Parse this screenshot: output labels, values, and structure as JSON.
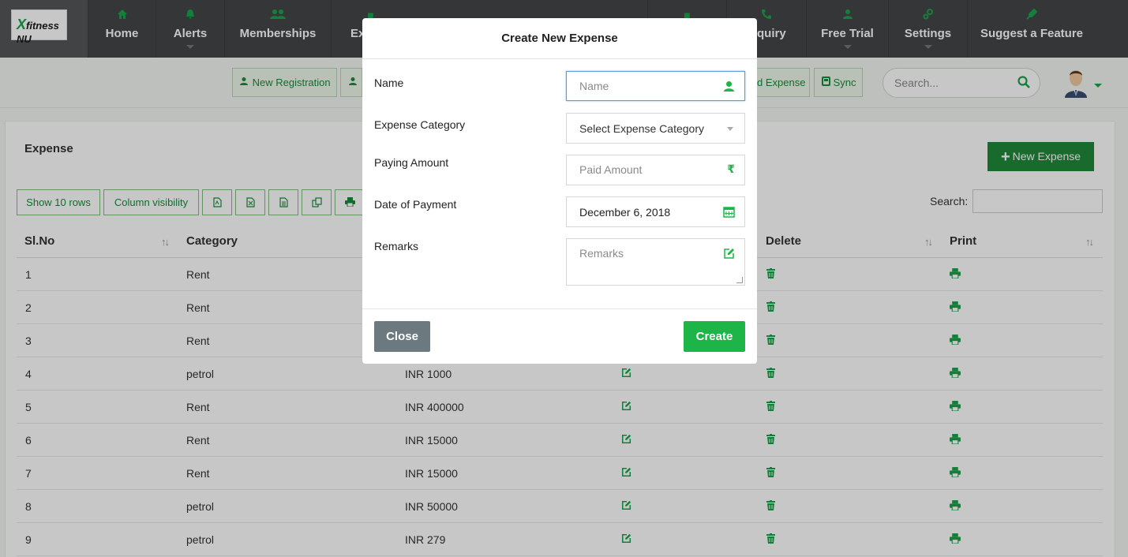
{
  "brand": {
    "logo_text": "fitness NU"
  },
  "nav": [
    {
      "key": "home",
      "label": "Home",
      "icon": "home-icon"
    },
    {
      "key": "alerts",
      "label": "Alerts",
      "icon": "bell-icon",
      "dropdown": true
    },
    {
      "key": "memberships",
      "label": "Memberships",
      "icon": "users-icon"
    },
    {
      "key": "expense",
      "label": "Ex",
      "icon": "money-icon"
    },
    {
      "key": "enquiry",
      "label": "quiry",
      "icon": "phone-icon"
    },
    {
      "key": "free_trial",
      "label": "Free Trial",
      "icon": "user-icon",
      "dropdown": true
    },
    {
      "key": "settings",
      "label": "Settings",
      "icon": "gears-icon",
      "dropdown": true
    },
    {
      "key": "suggest",
      "label": "Suggest a Feature",
      "icon": "microphone-icon"
    }
  ],
  "toolbar": {
    "new_registration": "New Registration",
    "add_expense": "d Expense",
    "sync": "Sync",
    "search_placeholder": "Search..."
  },
  "page": {
    "title": "Expense",
    "new_expense_label": "New Expense",
    "show_rows_label": "Show 10 rows",
    "column_visibility_label": "Column visibility",
    "search_label": "Search:"
  },
  "table": {
    "headers": {
      "slno": "Sl.No",
      "category": "Category",
      "delete": "Delete",
      "print": "Print"
    },
    "rows": [
      {
        "slno": "1",
        "category": "Rent",
        "amount": ""
      },
      {
        "slno": "2",
        "category": "Rent",
        "amount": ""
      },
      {
        "slno": "3",
        "category": "Rent",
        "amount": ""
      },
      {
        "slno": "4",
        "category": "petrol",
        "amount": "INR 1000"
      },
      {
        "slno": "5",
        "category": "Rent",
        "amount": "INR 400000"
      },
      {
        "slno": "6",
        "category": "Rent",
        "amount": "INR 15000"
      },
      {
        "slno": "7",
        "category": "Rent",
        "amount": "INR 15000"
      },
      {
        "slno": "8",
        "category": "petrol",
        "amount": "INR 50000"
      },
      {
        "slno": "9",
        "category": "petrol",
        "amount": "INR 279"
      }
    ]
  },
  "modal": {
    "title": "Create New Expense",
    "name_label": "Name",
    "name_placeholder": "Name",
    "category_label": "Expense Category",
    "category_value": "Select Expense Category",
    "amount_label": "Paying Amount",
    "amount_placeholder": "Paid Amount",
    "date_label": "Date of Payment",
    "date_value": "December 6, 2018",
    "remarks_label": "Remarks",
    "remarks_placeholder": "Remarks",
    "close_label": "Close",
    "create_label": "Create"
  },
  "colors": {
    "brand_green": "#1aa34a",
    "nav_bg": "#444648",
    "create_green": "#1db548",
    "close_gray": "#6c7a80"
  }
}
